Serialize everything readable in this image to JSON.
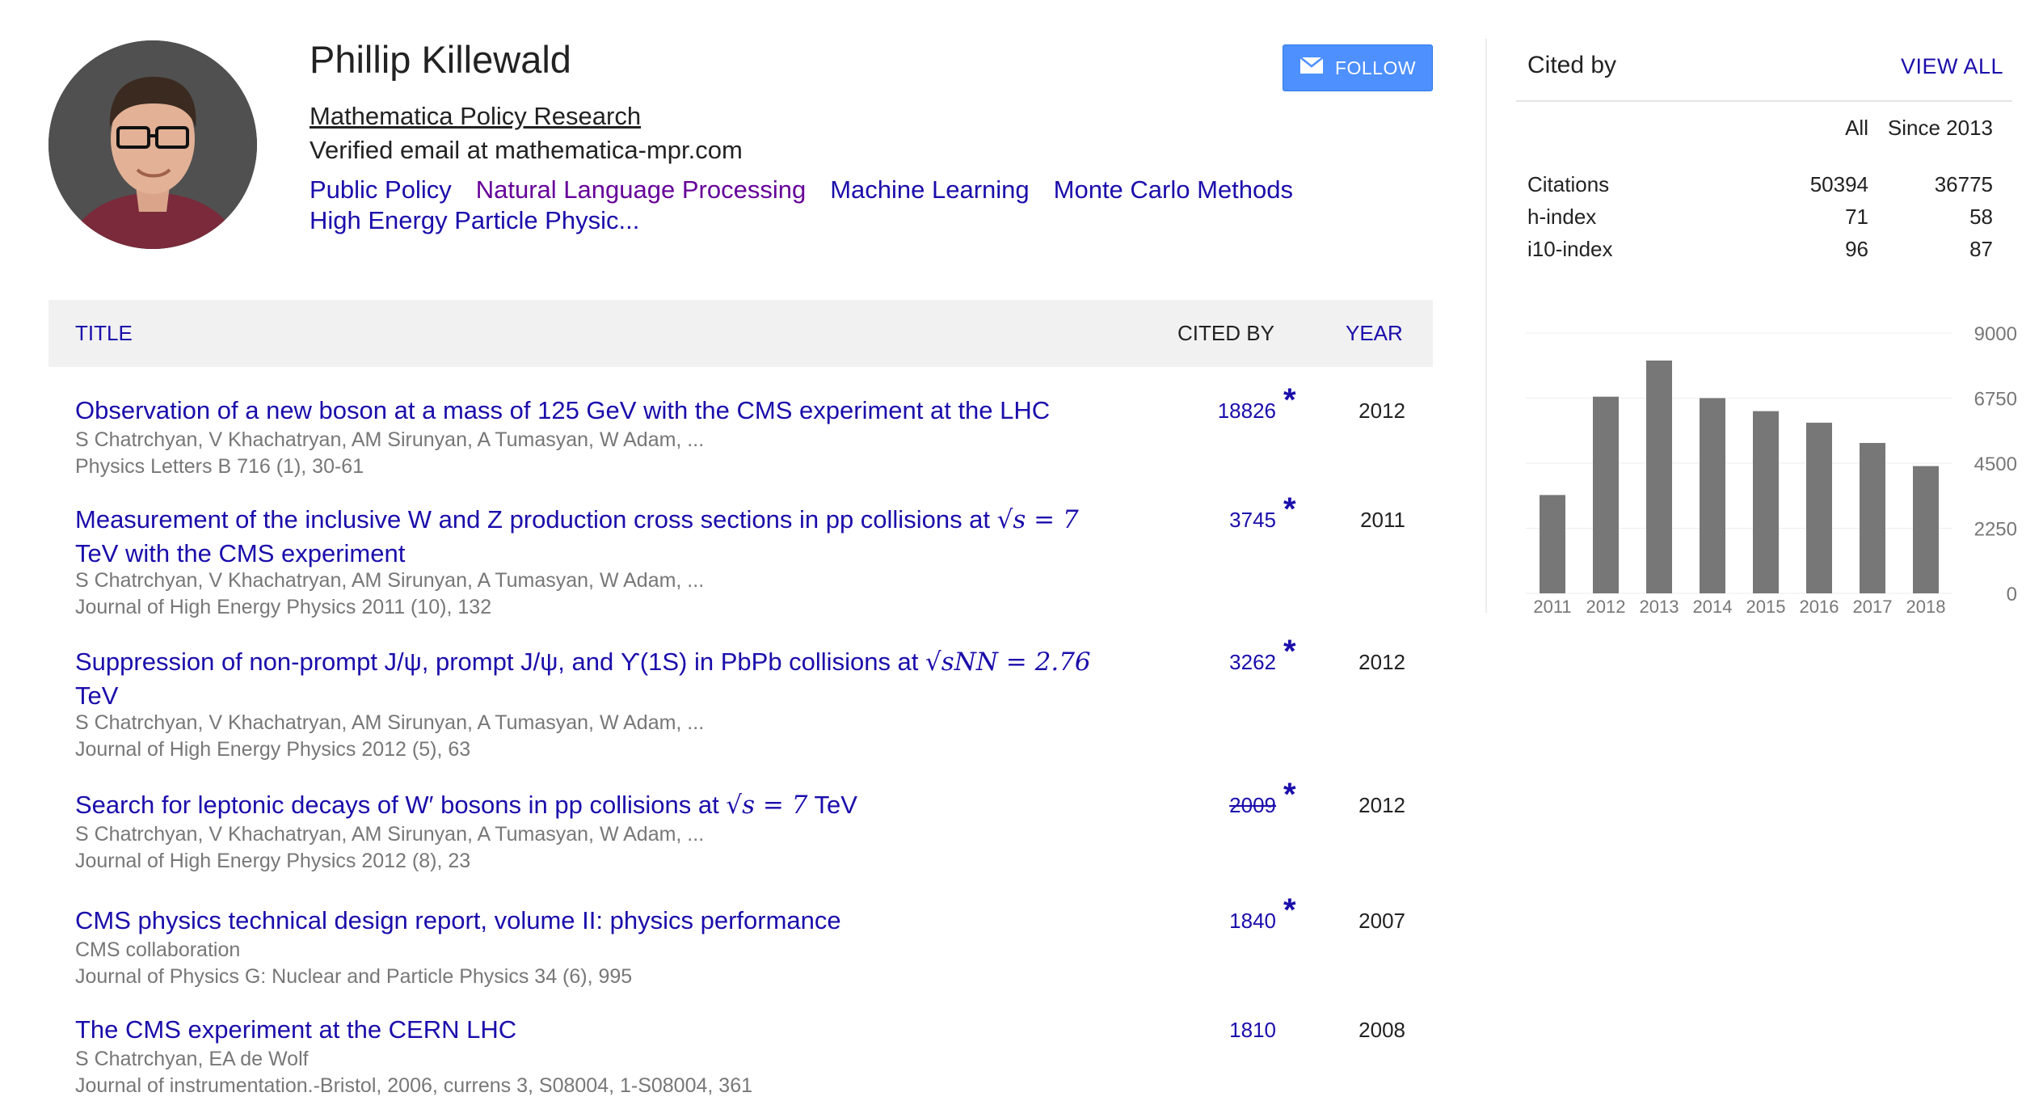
{
  "profile": {
    "name": "Phillip Killewald",
    "affiliation": "Mathematica Policy Research",
    "email": "Verified email at mathematica-mpr.com",
    "interests": [
      "Public Policy",
      "Natural Language Processing",
      "Machine Learning",
      "Monte Carlo Methods",
      "High Energy Particle Physic..."
    ],
    "follow_label": "FOLLOW",
    "follow_icon": "envelope-icon"
  },
  "table": {
    "headers": {
      "title": "TITLE",
      "cited_by": "CITED BY",
      "year": "YEAR"
    },
    "rows": [
      {
        "title": "Observation of a new boson at a mass of 125 GeV with the CMS experiment at the LHC",
        "authors": "S Chatrchyan, V Khachatryan, AM Sirunyan, A Tumasyan, W Adam, ...",
        "venue": "Physics Letters B 716 (1), 30-61",
        "cited_by": "18826",
        "year": "2012",
        "star": "*"
      },
      {
        "title_pre": "Measurement of the inclusive W and Z production cross sections in pp collisions at ",
        "title_math": "√s = 7",
        "title_post": "TeV with the CMS experiment",
        "authors": "S Chatrchyan, V Khachatryan, AM Sirunyan, A Tumasyan, W Adam, ...",
        "venue": "Journal of High Energy Physics 2011 (10), 132",
        "cited_by": "3745",
        "year": "2011",
        "star": "*"
      },
      {
        "title_pre": "Suppression of non-prompt J/ψ, prompt J/ψ, and ϒ(1S) in PbPb collisions at ",
        "title_math": "√sNN = 2.76",
        "title_post": "TeV",
        "authors": "S Chatrchyan, V Khachatryan, AM Sirunyan, A Tumasyan, W Adam, ...",
        "venue": "Journal of High Energy Physics 2012 (5), 63",
        "cited_by": "3262",
        "year": "2012",
        "star": "*"
      },
      {
        "title_pre": "Search for leptonic decays of W′ bosons in pp collisions at ",
        "title_math": "√s = 7",
        "title_post": " TeV",
        "authors": "S Chatrchyan, V Khachatryan, AM Sirunyan, A Tumasyan, W Adam, ...",
        "venue": "Journal of High Energy Physics 2012 (8), 23",
        "cited_by": "2009",
        "year": "2012",
        "star": "*"
      },
      {
        "title": "CMS physics technical design report, volume II: physics performance",
        "authors": "CMS collaboration",
        "venue": "Journal of Physics G: Nuclear and Particle Physics 34 (6), 995",
        "cited_by": "1840",
        "year": "2007",
        "star": "*"
      },
      {
        "title": "The CMS experiment at the CERN LHC",
        "authors": "S Chatrchyan, EA de Wolf",
        "venue": "Journal of instrumentation.-Bristol, 2006, currens 3, S08004, 1-S08004, 361",
        "cited_by": "1810",
        "year": "2008"
      }
    ]
  },
  "cited_by": {
    "title": "Cited by",
    "view_all": "VIEW ALL",
    "columns": [
      "All",
      "Since 2013"
    ],
    "rows": [
      {
        "label": "Citations",
        "all": "50394",
        "since": "36775"
      },
      {
        "label": "h-index",
        "all": "71",
        "since": "58"
      },
      {
        "label": "i10-index",
        "all": "96",
        "since": "87"
      }
    ]
  },
  "chart_data": {
    "type": "bar",
    "categories": [
      "2011",
      "2012",
      "2013",
      "2014",
      "2015",
      "2016",
      "2017",
      "2018"
    ],
    "values": [
      3400,
      6800,
      8050,
      6750,
      6300,
      5900,
      5200,
      4400
    ],
    "yticks": [
      "9000",
      "6750",
      "4500",
      "2250",
      "0"
    ],
    "ylim": [
      0,
      9000
    ],
    "bar_color": "#777777"
  }
}
